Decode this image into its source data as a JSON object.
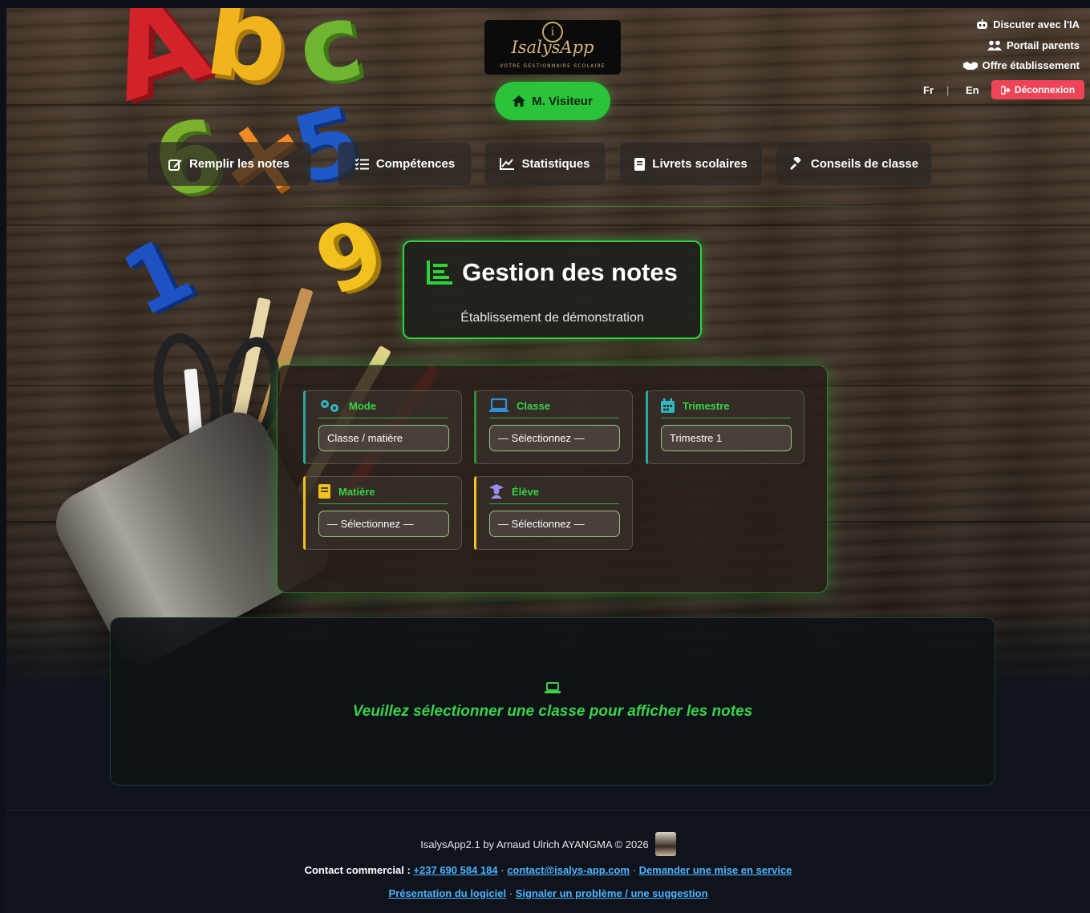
{
  "header": {
    "logo_name": "IsalysApp",
    "logo_tagline": "VOTRE GESTIONNAIRE SCOLAIRE",
    "user_label": "M. Visiteur"
  },
  "top_links": {
    "chat_ai": "Discuter avec l'IA",
    "parents_portal": "Portail parents",
    "school_offer": "Offre établissement",
    "lang_fr": "Fr",
    "lang_sep": "|",
    "lang_en": "En",
    "logout": "Déconnexion"
  },
  "nav": {
    "items": [
      {
        "label": "Remplir les notes",
        "icon": "edit-icon"
      },
      {
        "label": "Compétences",
        "icon": "checklist-icon"
      },
      {
        "label": "Statistiques",
        "icon": "chart-line-icon"
      },
      {
        "label": "Livrets scolaires",
        "icon": "book-icon"
      },
      {
        "label": "Conseils de classe",
        "icon": "gavel-icon"
      }
    ]
  },
  "title_card": {
    "title": "Gestion des notes",
    "subtitle": "Établissement de démonstration"
  },
  "filters": {
    "mode": {
      "label": "Mode",
      "value": "Classe / matière",
      "accent": "#2aa8a0"
    },
    "classe": {
      "label": "Classe",
      "value": "— Sélectionnez —",
      "accent": "#2f8f3a"
    },
    "trimestre": {
      "label": "Trimestre",
      "value": "Trimestre 1",
      "accent": "#2aa8a0"
    },
    "matiere": {
      "label": "Matière",
      "value": "— Sélectionnez —",
      "accent": "#f2c21e"
    },
    "eleve": {
      "label": "Élève",
      "value": "— Sélectionnez —",
      "accent": "#f2c21e"
    }
  },
  "empty_state": {
    "message": "Veuillez sélectionner une classe pour afficher les notes"
  },
  "footer": {
    "credit": "IsalysApp2.1 by Arnaud Ulrich AYANGMA © 2026",
    "contact_label": "Contact commercial :",
    "phone": "+237 690 584 184",
    "email": "contact@isalys-app.com",
    "request": "Demander une mise en service",
    "presentation": "Présentation du logiciel",
    "report": "Signaler un problème / une suggestion",
    "sep": "·"
  },
  "colors": {
    "accent_green": "#2fd13f",
    "logout_red": "#ef4458",
    "link_blue": "#4fb3ff"
  }
}
